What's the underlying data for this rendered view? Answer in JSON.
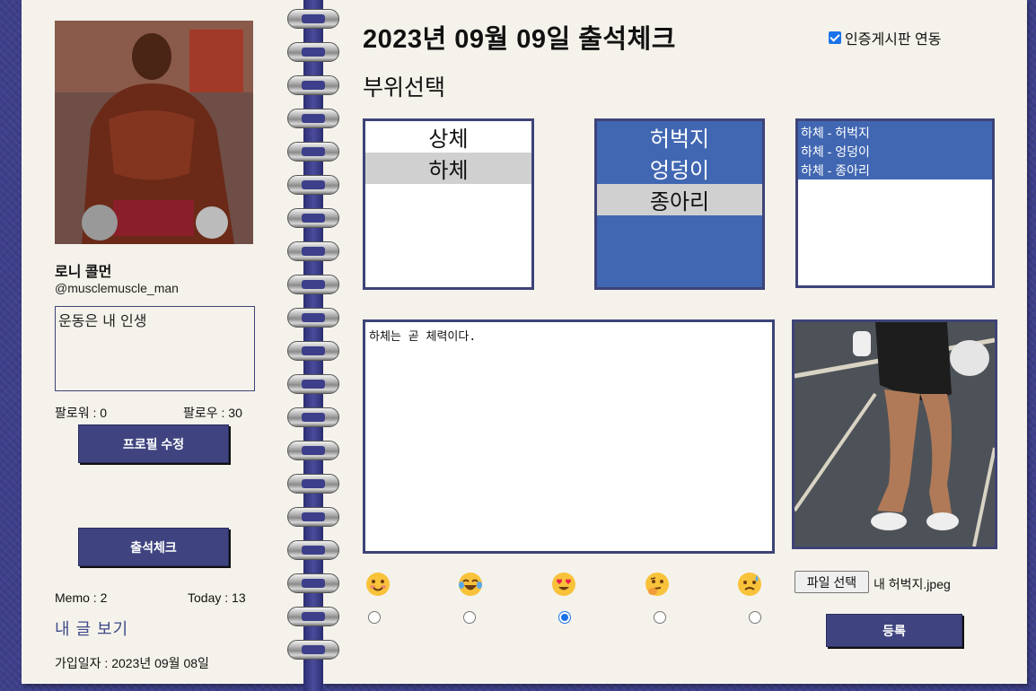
{
  "profile": {
    "name": "로니 콜먼",
    "handle": "@musclemuscle_man",
    "bio": "운동은 내 인생",
    "follower": "팔로워 : 0",
    "following": "팔로우 : 30",
    "edit_button": "프로필 수정",
    "attendance_button": "출석체크",
    "memo_count": "Memo : 2",
    "today_count": "Today : 13",
    "my_posts_link": "내 글 보기",
    "joined": "가입일자 : 2023년 09월 08일"
  },
  "main": {
    "title": "2023년 09월 09일 출석체크",
    "cert_board_label": "인증게시판 연동",
    "cert_board_checked": true,
    "section_label": "부위선택",
    "upper_list": [
      "상체",
      "하체"
    ],
    "upper_selected": "하체",
    "lower_list": [
      "허벅지",
      "엉덩이",
      "종아리"
    ],
    "lower_selected": "종아리",
    "picked_list": [
      "하체 - 허벅지",
      "하체 - 엉덩이",
      "하체 - 종아리"
    ],
    "memo_text": "하체는 곧 체력이다.",
    "moods": [
      "smiling-face-icon",
      "laughing-tears-icon",
      "heart-eyes-icon",
      "thinking-face-icon",
      "sad-sweat-icon"
    ],
    "selected_mood_index": 2,
    "file_button": "파일 선택",
    "file_name": "내 허벅지.jpeg",
    "submit_button": "등록"
  },
  "colors": {
    "navy": "#3f4480",
    "listbox_blue": "#4167b2",
    "page": "#f4f2ea",
    "background": "#3d3f8a"
  }
}
